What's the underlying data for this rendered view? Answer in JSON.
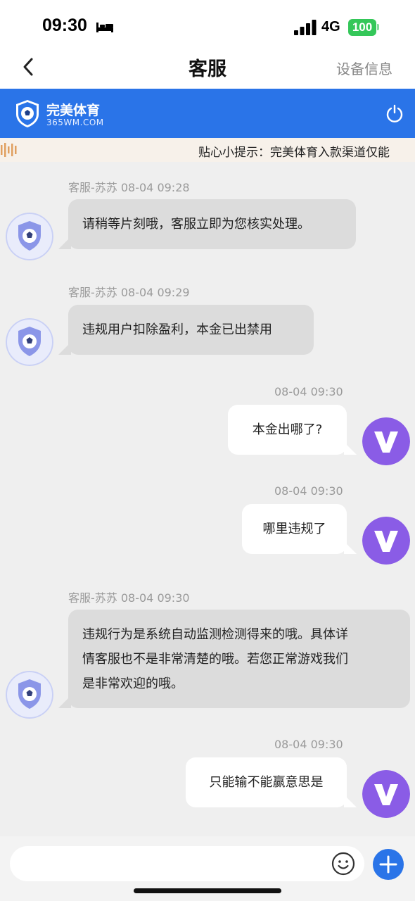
{
  "status_bar": {
    "time": "09:30",
    "network": "4G",
    "battery": "100",
    "icons": [
      "bed-icon",
      "signal-icon",
      "battery-icon"
    ]
  },
  "nav": {
    "title": "客服",
    "action": "设备信息",
    "back_icon": "chevron-left-icon"
  },
  "brand": {
    "name": "完美体育",
    "domain": "365WM.COM",
    "color": "#2a74e8",
    "power_icon": "power-icon"
  },
  "notice": {
    "text": "贴心小提示：完美体育入款渠道仅能"
  },
  "messages": [
    {
      "sender": "agent",
      "meta": "客服-苏苏  08-04 09:28",
      "lines": [
        "请稍等片刻哦，客服立即为您核实处理。"
      ]
    },
    {
      "sender": "agent",
      "meta": "客服-苏苏  08-04 09:29",
      "lines": [
        "违规用户扣除盈利，本金已出禁用"
      ]
    },
    {
      "sender": "user",
      "meta": "08-04 09:30",
      "lines": [
        "本金出哪了?"
      ]
    },
    {
      "sender": "user",
      "meta": "08-04 09:30",
      "lines": [
        "哪里违规了"
      ]
    },
    {
      "sender": "agent",
      "meta": "客服-苏苏  08-04 09:30",
      "lines": [
        "违规行为是系统自动监测检测得来的哦。具体详",
        "情客服也不是非常清楚的哦。若您正常游戏我们",
        "是非常欢迎的哦。"
      ]
    },
    {
      "sender": "user",
      "meta": "08-04 09:30",
      "lines": [
        "只能输不能赢意思是"
      ]
    }
  ],
  "input": {
    "placeholder": "",
    "value": ""
  },
  "colors": {
    "accent": "#2a74e8",
    "agent_bubble": "#dcdcdc",
    "user_bubble": "#ffffff",
    "user_avatar": "#8a5ce6"
  }
}
